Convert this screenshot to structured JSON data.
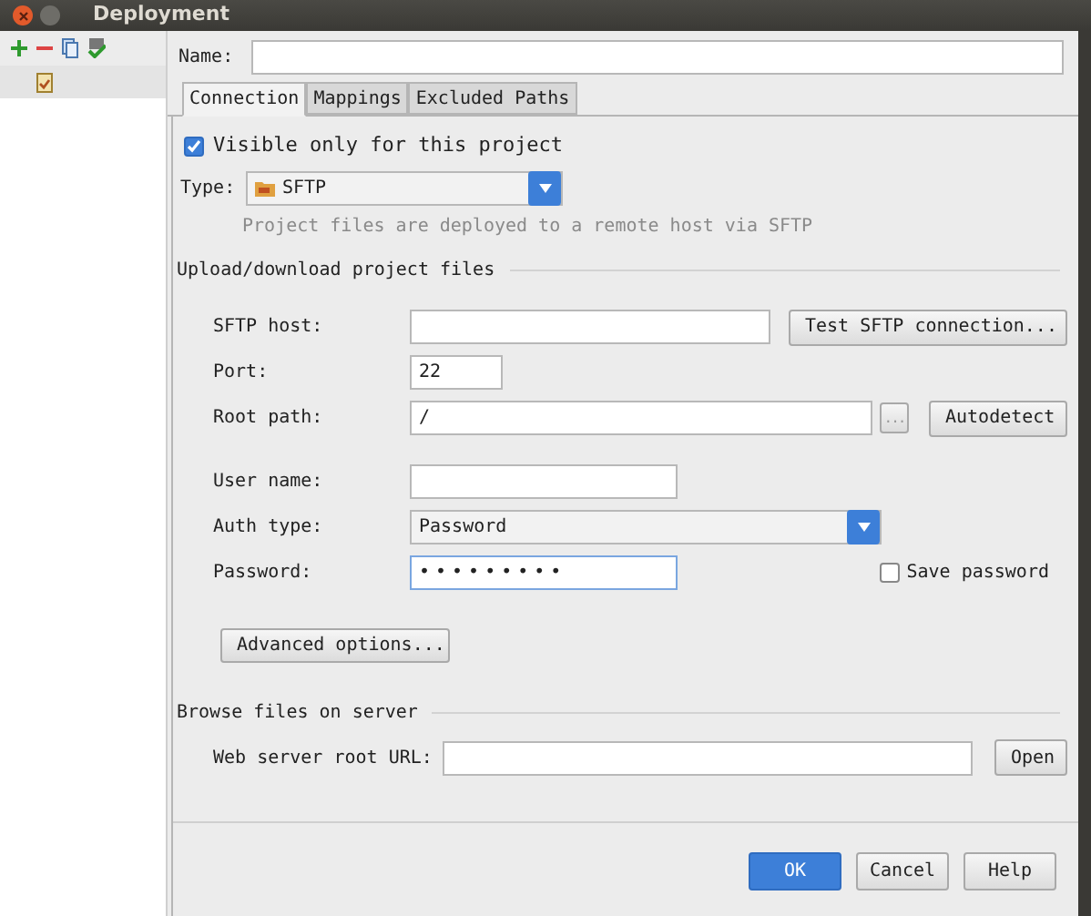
{
  "window": {
    "title": "Deployment"
  },
  "name_field": {
    "label": "Name:"
  },
  "tabs": [
    {
      "label": "Connection",
      "selected": true
    },
    {
      "label": "Mappings",
      "selected": false
    },
    {
      "label": "Excluded Paths",
      "selected": false
    }
  ],
  "visible_only": {
    "label": "Visible only for this project",
    "checked": true
  },
  "type": {
    "label": "Type:",
    "value": "SFTP",
    "hint": "Project files are deployed to a remote host via SFTP"
  },
  "upload_section": {
    "title": "Upload/download project files",
    "fields": [
      {
        "kind": "text",
        "label": "SFTP host:",
        "button": "Test SFTP connection..."
      },
      {
        "kind": "short",
        "label": "Port:",
        "value": "22"
      },
      {
        "kind": "path",
        "label": "Root path:",
        "value": "/",
        "browse": "...",
        "button": "Autodetect"
      },
      {
        "kind": "user",
        "label": "User name:"
      },
      {
        "kind": "select",
        "label": "Auth type:",
        "value": "Password"
      },
      {
        "kind": "password",
        "label": "Password:",
        "value": "•••••••••",
        "checkbox": {
          "label": "Save password",
          "checked": false
        }
      }
    ],
    "advanced_button": "Advanced options..."
  },
  "browse_section": {
    "title": "Browse files on server",
    "label": "Web server root URL:",
    "button": "Open"
  },
  "buttons": [
    {
      "label": "OK",
      "default": true
    },
    {
      "label": "Cancel",
      "default": false
    },
    {
      "label": "Help",
      "default": false
    }
  ]
}
